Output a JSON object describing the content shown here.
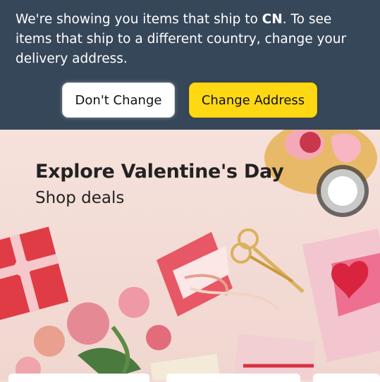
{
  "banner": {
    "message_pre": "We're showing you items that ship to ",
    "country": "CN",
    "message_post": ". To see items that ship to a different country, change your delivery address.",
    "keep_label": "Don't Change",
    "change_label": "Change Address"
  },
  "hero": {
    "title": "Explore Valentine's Day",
    "subtitle": "Shop deals"
  },
  "colors": {
    "banner_bg": "#37475a",
    "change_button": "#ffd814",
    "keep_button": "#ffffff"
  }
}
